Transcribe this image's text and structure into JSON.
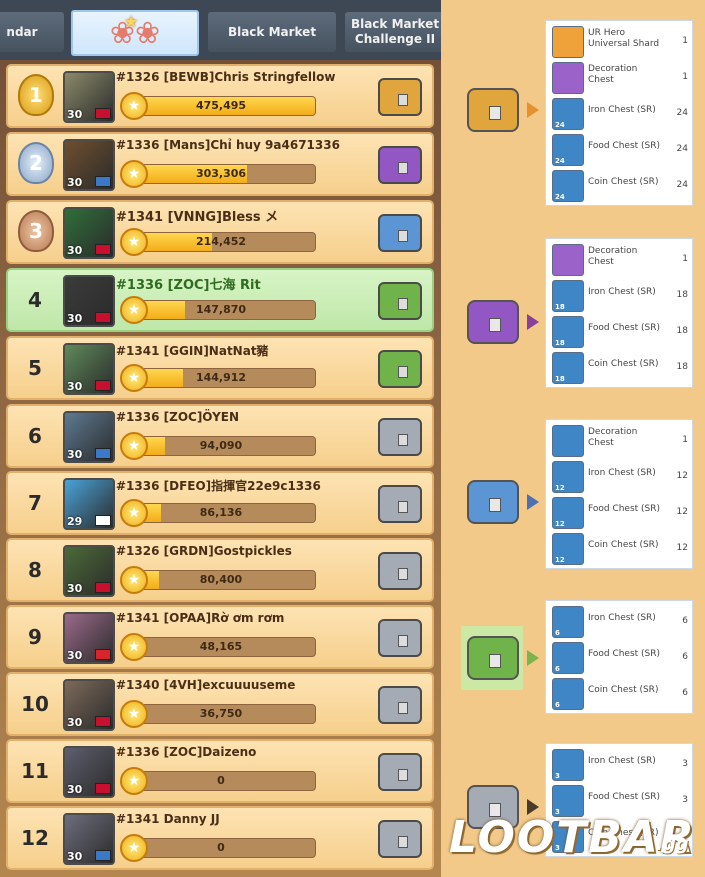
{
  "tabs": [
    {
      "label": "ndar",
      "active": false
    },
    {
      "label": "",
      "active": true,
      "icon": "rose-trophy-icon"
    },
    {
      "label": "Black Market",
      "active": false
    },
    {
      "label": "Black Market\nChallenge II",
      "active": false
    }
  ],
  "leaderboard": [
    {
      "rank": "1",
      "name": "#1326 [BEWB]Chris Stringfellow",
      "level": "30",
      "value": "475,495",
      "fill": 1.0,
      "chest": "gold"
    },
    {
      "rank": "2",
      "name": "#1336 [Mans]Chỉ huy 9a4671336",
      "level": "30",
      "value": "303,306",
      "fill": 0.64,
      "chest": "purple"
    },
    {
      "rank": "3",
      "name": "#1341 [VNNG]Bless メ",
      "level": "30",
      "value": "214,452",
      "fill": 0.45,
      "chest": "blue"
    },
    {
      "rank": "4",
      "name": "#1336 [ZOC]七海 Rit",
      "level": "30",
      "value": "147,870",
      "fill": 0.31,
      "chest": "green"
    },
    {
      "rank": "5",
      "name": "#1341 [GGIN]NatNat豬",
      "level": "30",
      "value": "144,912",
      "fill": 0.3,
      "chest": "green"
    },
    {
      "rank": "6",
      "name": "#1336 [ZOC]ÖYEN",
      "level": "30",
      "value": "94,090",
      "fill": 0.2,
      "chest": "silver"
    },
    {
      "rank": "7",
      "name": "#1336 [DFEO]指揮官22e9c1336",
      "level": "29",
      "value": "86,136",
      "fill": 0.18,
      "chest": "silver"
    },
    {
      "rank": "8",
      "name": "#1326 [GRDN]Gostpickles",
      "level": "30",
      "value": "80,400",
      "fill": 0.17,
      "chest": "silver"
    },
    {
      "rank": "9",
      "name": "#1341 [OPAA]Rờ ơm rơm",
      "level": "30",
      "value": "48,165",
      "fill": 0.0,
      "chest": "silver"
    },
    {
      "rank": "10",
      "name": "#1340 [4VH]excuuuuseme",
      "level": "30",
      "value": "36,750",
      "fill": 0.0,
      "chest": "silver"
    },
    {
      "rank": "11",
      "name": "#1336 [ZOC]Daizeno",
      "level": "30",
      "value": "0",
      "fill": 0.0,
      "chest": "silver"
    },
    {
      "rank": "12",
      "name": "#1341 Danny JJ",
      "level": "30",
      "value": "0",
      "fill": 0.0,
      "chest": "silver"
    }
  ],
  "reward_tiers": [
    {
      "chest": "gold",
      "rewards": [
        {
          "name": "UR Hero\nUniversal Shard",
          "qty": "1",
          "icon": "hero-shard-icon",
          "color": "#f0a23a"
        },
        {
          "name": "Decoration\nChest",
          "qty": "1",
          "icon": "decoration-chest-icon",
          "color": "#9b62c9"
        },
        {
          "name": "Iron Chest (SR)",
          "qty": "24",
          "icon": "iron-chest-icon",
          "color": "#3f86c6",
          "count": "24"
        },
        {
          "name": "Food Chest (SR)",
          "qty": "24",
          "icon": "food-chest-icon",
          "color": "#3f86c6",
          "count": "24"
        },
        {
          "name": "Coin Chest (SR)",
          "qty": "24",
          "icon": "coin-chest-icon",
          "color": "#3f86c6",
          "count": "24"
        }
      ]
    },
    {
      "chest": "purple",
      "rewards": [
        {
          "name": "Decoration\nChest",
          "qty": "1",
          "icon": "decoration-chest-icon",
          "color": "#9b62c9"
        },
        {
          "name": "Iron Chest (SR)",
          "qty": "18",
          "icon": "iron-chest-icon",
          "color": "#3f86c6",
          "count": "18"
        },
        {
          "name": "Food Chest (SR)",
          "qty": "18",
          "icon": "food-chest-icon",
          "color": "#3f86c6",
          "count": "18"
        },
        {
          "name": "Coin Chest (SR)",
          "qty": "18",
          "icon": "coin-chest-icon",
          "color": "#3f86c6",
          "count": "18"
        }
      ]
    },
    {
      "chest": "blue",
      "rewards": [
        {
          "name": "Decoration\nChest",
          "qty": "1",
          "icon": "decoration-chest-icon",
          "color": "#3f86c6"
        },
        {
          "name": "Iron Chest (SR)",
          "qty": "12",
          "icon": "iron-chest-icon",
          "color": "#3f86c6",
          "count": "12"
        },
        {
          "name": "Food Chest (SR)",
          "qty": "12",
          "icon": "food-chest-icon",
          "color": "#3f86c6",
          "count": "12"
        },
        {
          "name": "Coin Chest (SR)",
          "qty": "12",
          "icon": "coin-chest-icon",
          "color": "#3f86c6",
          "count": "12"
        }
      ]
    },
    {
      "chest": "green",
      "rewards": [
        {
          "name": "Iron Chest (SR)",
          "qty": "6",
          "icon": "iron-chest-icon",
          "color": "#3f86c6",
          "count": "6"
        },
        {
          "name": "Food Chest (SR)",
          "qty": "6",
          "icon": "food-chest-icon",
          "color": "#3f86c6",
          "count": "6"
        },
        {
          "name": "Coin Chest (SR)",
          "qty": "6",
          "icon": "coin-chest-icon",
          "color": "#3f86c6",
          "count": "6"
        }
      ]
    },
    {
      "chest": "silver",
      "rewards": [
        {
          "name": "Iron Chest (SR)",
          "qty": "3",
          "icon": "iron-chest-icon",
          "color": "#3f86c6",
          "count": "3"
        },
        {
          "name": "Food Chest (SR)",
          "qty": "3",
          "icon": "food-chest-icon",
          "color": "#3f86c6",
          "count": "3"
        },
        {
          "name": "Coin Chest (SR)",
          "qty": "3",
          "icon": "coin-chest-icon",
          "color": "#3f86c6",
          "count": "3"
        }
      ]
    }
  ],
  "chest_colors": {
    "gold": "#e0a53c",
    "purple": "#9257c2",
    "blue": "#5b95d4",
    "green": "#6fb34a",
    "silver": "#a5abb5"
  },
  "watermark": {
    "text": "LOOTBAR",
    "suffix": ".gg"
  }
}
